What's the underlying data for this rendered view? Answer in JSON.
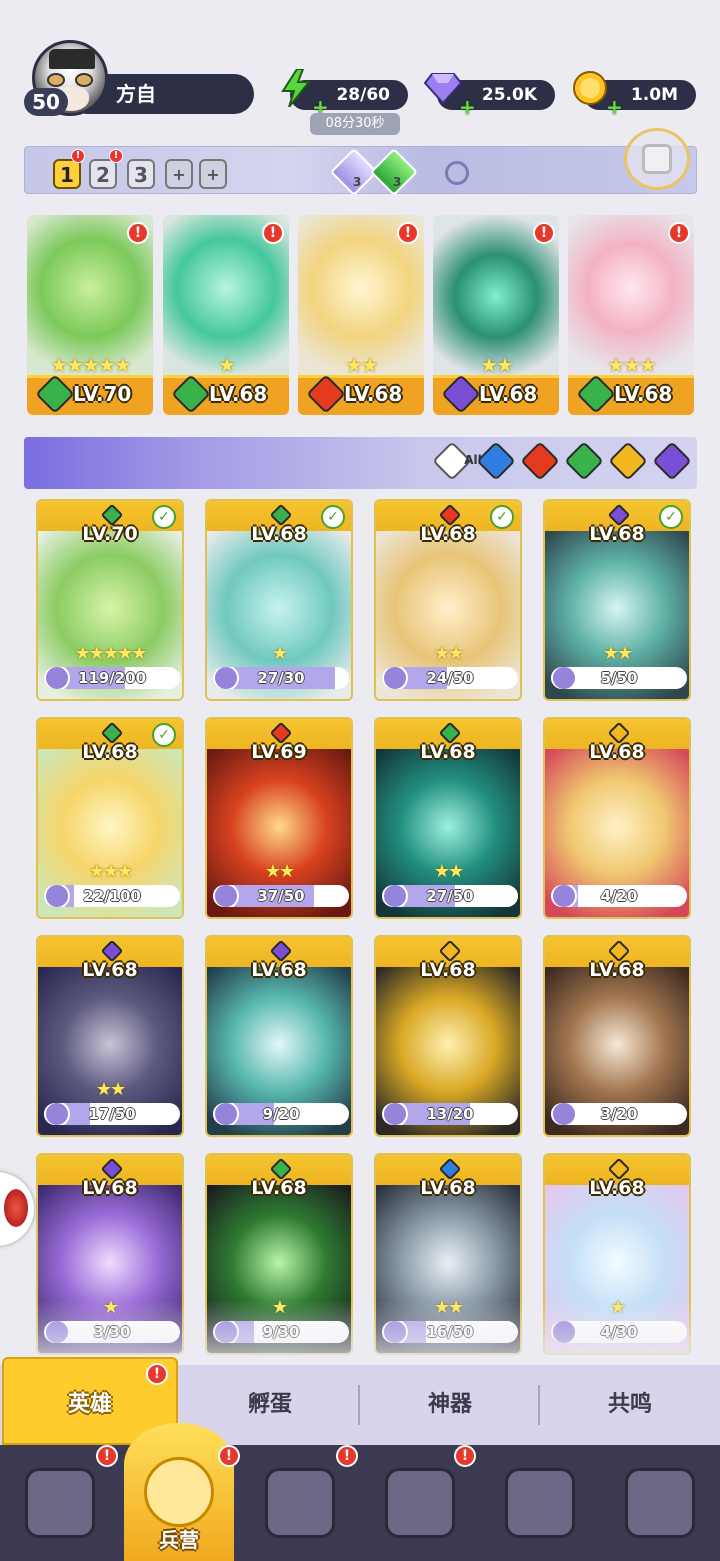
{
  "player": {
    "level": "50",
    "name": "方自"
  },
  "resources": {
    "energy": {
      "value": "28/60",
      "icon": "lightning-icon",
      "color": "#58d63b"
    },
    "gems": {
      "value": "25.0K",
      "icon": "diamond-icon",
      "color": "#9d7ff2"
    },
    "gold": {
      "value": "1.0M",
      "icon": "coin-icon",
      "color": "#ffc423"
    },
    "timer": "08分30秒"
  },
  "team_bar": {
    "slots": [
      "1",
      "2",
      "3"
    ],
    "add_symbol": "+",
    "alert_symbol": "!",
    "gem_counts": [
      "3",
      "3"
    ]
  },
  "team_cards": [
    {
      "level": "LV.70",
      "element": "nature",
      "stars": "★★★★★"
    },
    {
      "level": "LV.68",
      "element": "nature",
      "stars": "★"
    },
    {
      "level": "LV.68",
      "element": "fire",
      "stars": "★★"
    },
    {
      "level": "LV.68",
      "element": "dark",
      "stars": "★★"
    },
    {
      "level": "LV.68",
      "element": "nature",
      "stars": "★★★"
    }
  ],
  "filter": {
    "all_label": "All",
    "elements": [
      "water",
      "fire",
      "nature",
      "light",
      "dark"
    ]
  },
  "element_colors": {
    "nature": "#38b249",
    "fire": "#e53a1e",
    "dark": "#7a4fd6",
    "light": "#f3b81f",
    "water": "#2f7fe0"
  },
  "heroes": [
    {
      "level": "LV.70",
      "element": "nature",
      "shards": "119/200",
      "progress": 0.595,
      "stars": "★★★★★",
      "check": true
    },
    {
      "level": "LV.68",
      "element": "nature",
      "shards": "27/30",
      "progress": 0.9,
      "stars": "★",
      "check": true
    },
    {
      "level": "LV.68",
      "element": "fire",
      "shards": "24/50",
      "progress": 0.48,
      "stars": "★★",
      "check": true
    },
    {
      "level": "LV.68",
      "element": "dark",
      "shards": "5/50",
      "progress": 0.1,
      "stars": "★★",
      "check": true
    },
    {
      "level": "LV.68",
      "element": "nature",
      "shards": "22/100",
      "progress": 0.22,
      "stars": "★★★",
      "check": true
    },
    {
      "level": "LV.69",
      "element": "fire",
      "shards": "37/50",
      "progress": 0.74,
      "stars": "★★",
      "check": false
    },
    {
      "level": "LV.68",
      "element": "nature",
      "shards": "27/50",
      "progress": 0.54,
      "stars": "★★",
      "check": false
    },
    {
      "level": "LV.68",
      "element": "light",
      "shards": "4/20",
      "progress": 0.2,
      "stars": "",
      "check": false
    },
    {
      "level": "LV.68",
      "element": "dark",
      "shards": "17/50",
      "progress": 0.34,
      "stars": "★★",
      "check": false
    },
    {
      "level": "LV.68",
      "element": "dark",
      "shards": "9/20",
      "progress": 0.45,
      "stars": "",
      "check": false
    },
    {
      "level": "LV.68",
      "element": "light",
      "shards": "13/20",
      "progress": 0.65,
      "stars": "",
      "check": false
    },
    {
      "level": "LV.68",
      "element": "light",
      "shards": "3/20",
      "progress": 0.15,
      "stars": "",
      "check": false
    },
    {
      "level": "LV.68",
      "element": "dark",
      "shards": "3/30",
      "progress": 0.1,
      "stars": "★",
      "check": false
    },
    {
      "level": "LV.68",
      "element": "nature",
      "shards": "9/30",
      "progress": 0.3,
      "stars": "★",
      "check": false
    },
    {
      "level": "LV.68",
      "element": "water",
      "shards": "16/50",
      "progress": 0.32,
      "stars": "★★",
      "check": false
    },
    {
      "level": "LV.68",
      "element": "light",
      "shards": "4/30",
      "progress": 0.13,
      "stars": "★",
      "check": false
    }
  ],
  "tabs": [
    {
      "label": "英雄",
      "selected": true
    },
    {
      "label": "孵蛋",
      "selected": false
    },
    {
      "label": "神器",
      "selected": false
    },
    {
      "label": "共鸣",
      "selected": false
    }
  ],
  "bottom_nav": [
    {
      "icon": "cards-icon",
      "label": ""
    },
    {
      "icon": "barracks-icon",
      "label": "兵营"
    },
    {
      "icon": "book-icon",
      "label": ""
    },
    {
      "icon": "castle-icon",
      "label": ""
    },
    {
      "icon": "mushroom-icon",
      "label": ""
    },
    {
      "icon": "guild-banner-icon",
      "label": ""
    }
  ]
}
